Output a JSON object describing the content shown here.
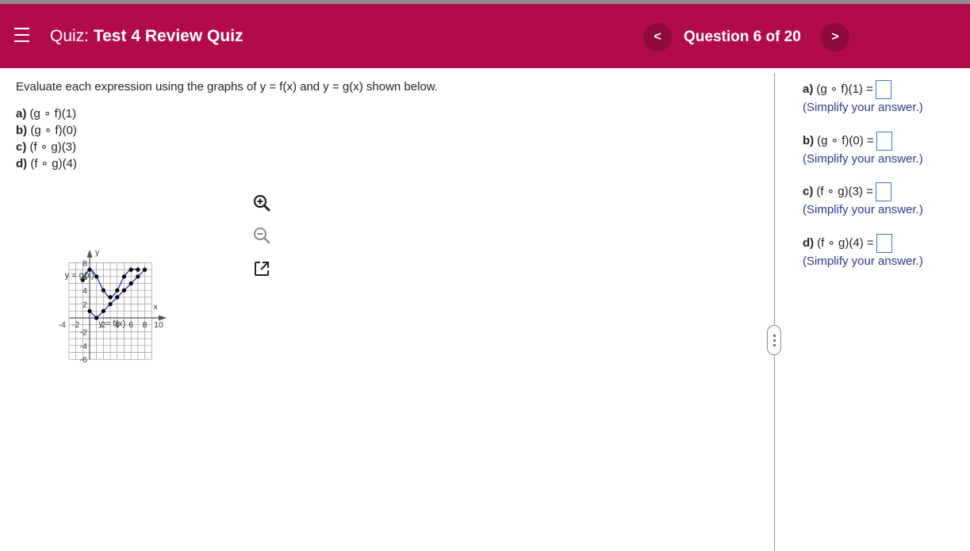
{
  "header": {
    "quiz_prefix": "Quiz:",
    "quiz_name": "Test 4 Review Quiz",
    "question_counter": "Question 6 of 20",
    "prev_label": "<",
    "next_label": ">"
  },
  "problem": {
    "instructions": "Evaluate each expression using the graphs of y = f(x) and y = g(x) shown below.",
    "parts": [
      {
        "label": "a)",
        "expr": "(g ∘ f)(1)"
      },
      {
        "label": "b)",
        "expr": "(g ∘ f)(0)"
      },
      {
        "label": "c)",
        "expr": "(f ∘ g)(3)"
      },
      {
        "label": "d)",
        "expr": "(f ∘ g)(4)"
      }
    ]
  },
  "graph": {
    "y_axis_label": "y",
    "x_axis_label": "x",
    "g_label": "y = g(x)",
    "f_label": "y = f(x)",
    "x_ticks": [
      "-4",
      "-2",
      "2",
      "4",
      "6",
      "8",
      "10"
    ],
    "y_ticks": [
      "8",
      "6",
      "4",
      "2",
      "-2",
      "-4",
      "-6"
    ],
    "x_tick_values": [
      -4,
      -2,
      2,
      4,
      6,
      8,
      10
    ],
    "y_tick_values": [
      8,
      6,
      4,
      2,
      -2,
      -4,
      -6
    ],
    "g_points": [
      [
        -1,
        5.5
      ],
      [
        0,
        7
      ],
      [
        1,
        6
      ],
      [
        2,
        4
      ],
      [
        3,
        3
      ],
      [
        4,
        4
      ],
      [
        5,
        6
      ],
      [
        6,
        7
      ],
      [
        7,
        7
      ]
    ],
    "f_points": [
      [
        0,
        1
      ],
      [
        1,
        0
      ],
      [
        2,
        1
      ],
      [
        3,
        2
      ],
      [
        4,
        3
      ],
      [
        5,
        4
      ],
      [
        6,
        5
      ],
      [
        7,
        6
      ],
      [
        8,
        7
      ]
    ],
    "colors": {
      "curve": "#1a2fd0",
      "point": "#000000",
      "grid": "#999999"
    }
  },
  "answers": [
    {
      "label": "a)",
      "expr": "(g ∘ f)(1) =",
      "value": "",
      "hint": "(Simplify your answer.)"
    },
    {
      "label": "b)",
      "expr": "(g ∘ f)(0) =",
      "value": "",
      "hint": "(Simplify your answer.)"
    },
    {
      "label": "c)",
      "expr": "(f ∘ g)(3) =",
      "value": "",
      "hint": "(Simplify your answer.)"
    },
    {
      "label": "d)",
      "expr": "(f ∘ g)(4) =",
      "value": "",
      "hint": "(Simplify your answer.)"
    }
  ],
  "icons": {
    "menu": "hamburger-menu-icon",
    "zoom_in": "zoom-in-icon",
    "zoom_out": "zoom-out-icon",
    "popout": "popout-icon",
    "divider_handle": "drag-handle-icon"
  },
  "colors": {
    "header_bg": "#b20b4c",
    "nav_btn_bg": "#8d0a3c",
    "answer_box_border": "#3a79c9",
    "hint_text": "#2a3a8a"
  }
}
